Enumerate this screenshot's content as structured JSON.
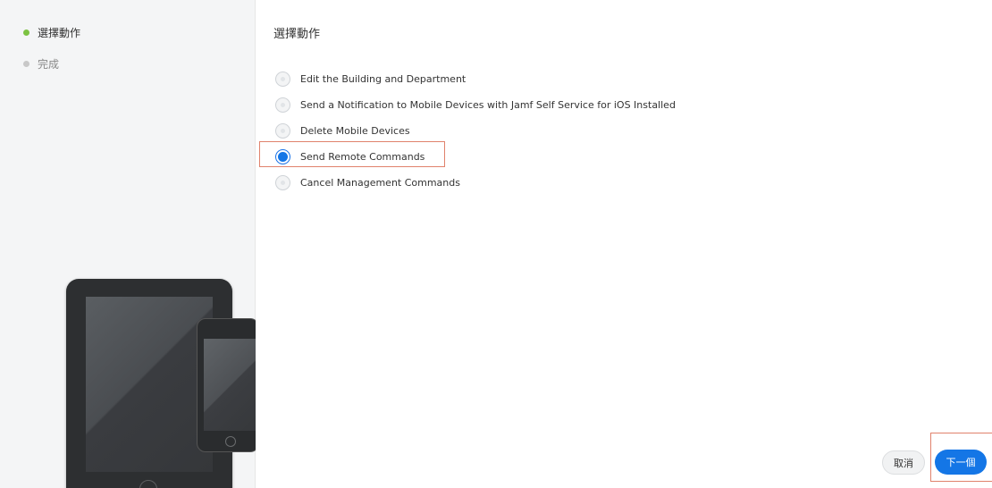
{
  "sidebar": {
    "steps": [
      {
        "label": "選擇動作",
        "dot_color": "#7cc242"
      },
      {
        "label": "完成",
        "dot_color": "#c8c8c8"
      }
    ]
  },
  "main": {
    "title": "選擇動作",
    "options": [
      {
        "label": "Edit the Building and Department",
        "selected": false
      },
      {
        "label": "Send a Notification to Mobile Devices with Jamf Self Service for iOS Installed",
        "selected": false
      },
      {
        "label": "Delete Mobile Devices",
        "selected": false
      },
      {
        "label": "Send Remote Commands",
        "selected": true
      },
      {
        "label": "Cancel Management Commands",
        "selected": false
      }
    ]
  },
  "footer": {
    "cancel_label": "取消",
    "next_label": "下一個"
  },
  "colors": {
    "accent": "#1476e6",
    "highlight_outline": "#e0826c",
    "active_step": "#7cc242",
    "inactive_step": "#c8c8c8"
  }
}
